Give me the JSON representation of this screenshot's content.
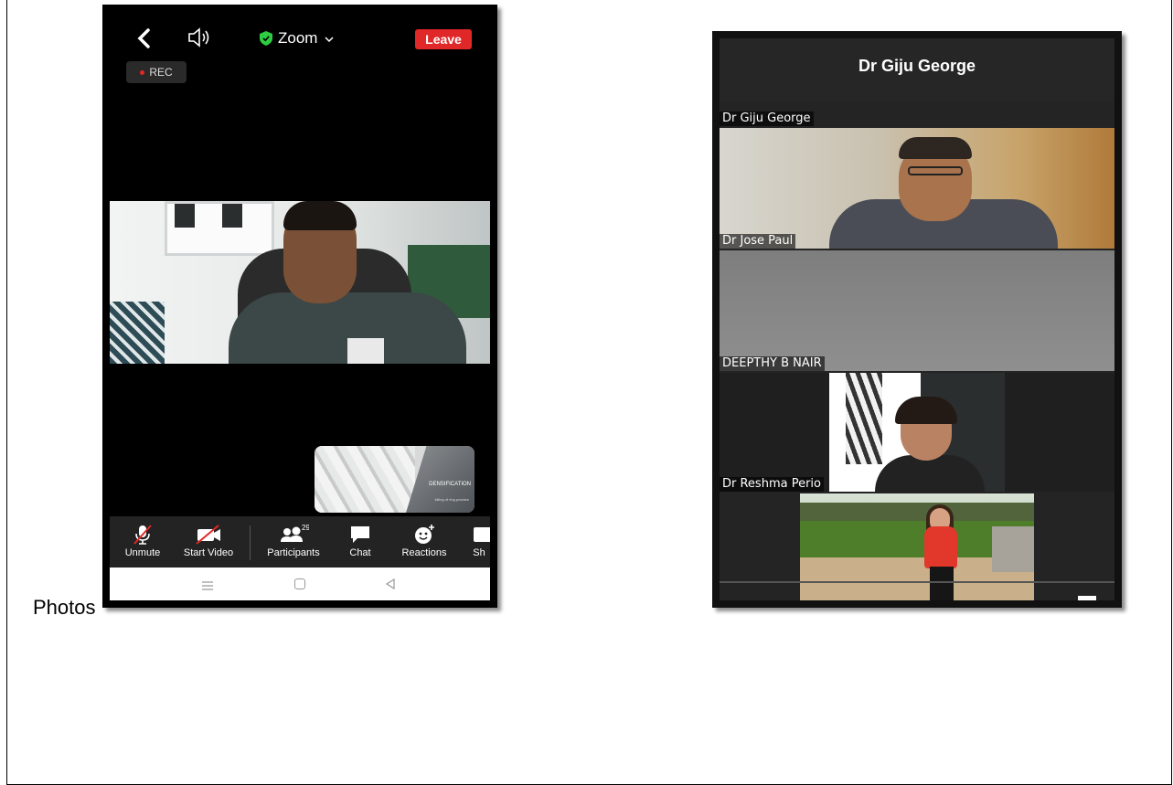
{
  "caption": "Photos",
  "phone1": {
    "meeting_label": "Zoom",
    "leave_label": "Leave",
    "rec_label": "REC",
    "shared_screen": {
      "title": "DENSIFICATION",
      "subtitle": "killing of ring practice"
    },
    "toolbar": {
      "unmute": "Unmute",
      "start_video": "Start Video",
      "participants": "Participants",
      "participants_count": "29",
      "chat": "Chat",
      "reactions": "Reactions",
      "share": "Sh"
    }
  },
  "phone2": {
    "active_speaker": "Dr Giju George",
    "tiles": [
      {
        "label": "Dr Giju George"
      },
      {
        "label": "Dr Jose Paul"
      },
      {
        "label": "DEEPTHY B NAIR"
      },
      {
        "label": "Dr Reshma Perio"
      }
    ]
  },
  "colors": {
    "leave": "#e02828",
    "shield": "#2ecc40",
    "toolbar_bg": "#232323"
  },
  "icons": [
    "back-arrow-icon",
    "speaker-icon",
    "shield-icon",
    "chevron-down-icon",
    "mic-muted-icon",
    "video-off-icon",
    "participants-icon",
    "chat-icon",
    "reactions-icon",
    "share-icon",
    "nav-menu-icon",
    "nav-home-icon",
    "nav-back-icon"
  ]
}
